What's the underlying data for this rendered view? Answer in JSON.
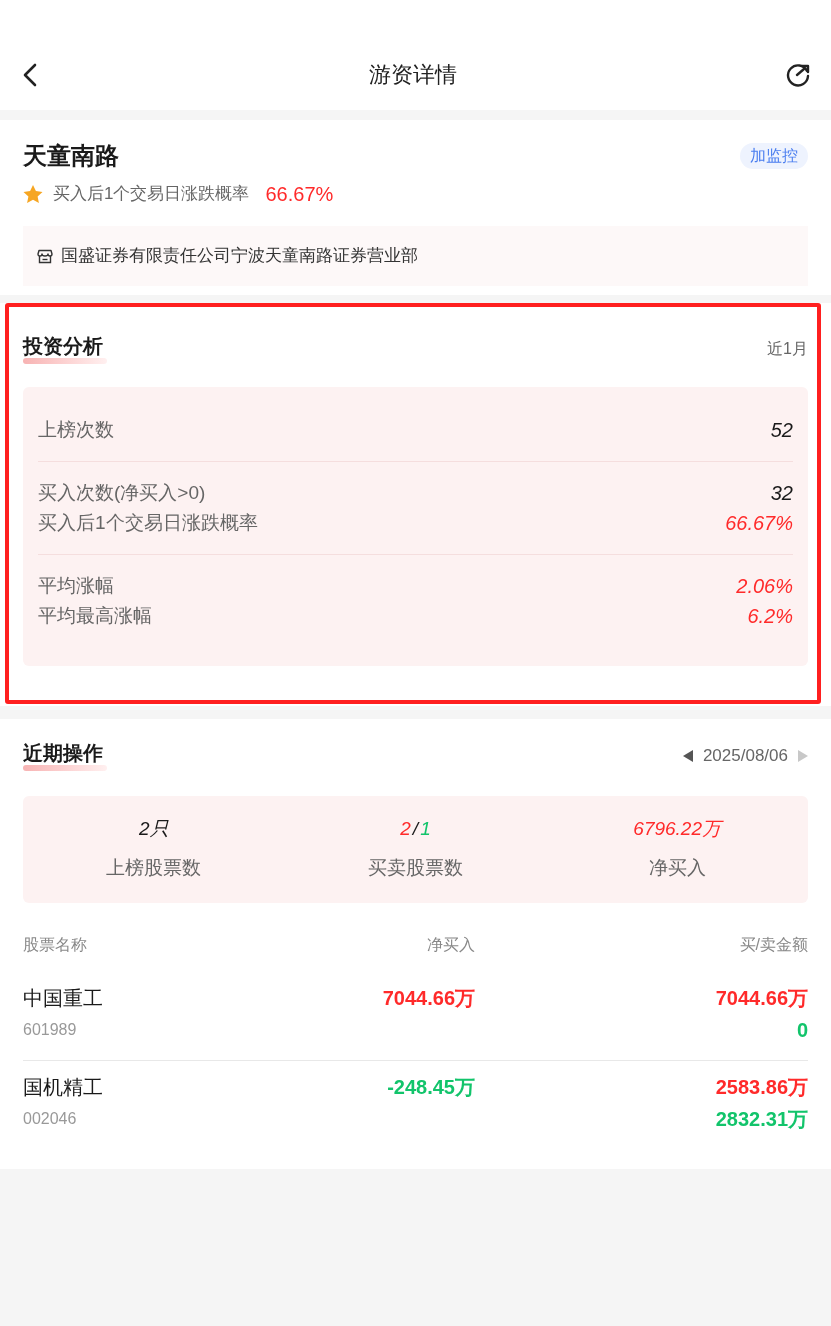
{
  "nav": {
    "title": "游资详情"
  },
  "trader": {
    "name": "天童南路",
    "monitor_button": "加监控",
    "rate_label": "买入后1个交易日涨跌概率",
    "rate_value": "66.67%",
    "branch": "国盛证券有限责任公司宁波天童南路证券营业部"
  },
  "analysis": {
    "title": "投资分析",
    "period": "近1月",
    "highlighted": true,
    "groups": [
      {
        "rows": [
          {
            "label": "上榜次数",
            "value": "52",
            "color": "#1a1a1a"
          }
        ]
      },
      {
        "rows": [
          {
            "label": "买入次数(净买入>0)",
            "value": "32",
            "color": "#1a1a1a"
          },
          {
            "label": "买入后1个交易日涨跌概率",
            "value": "66.67%",
            "color": "#ff2a2a"
          }
        ]
      },
      {
        "rows": [
          {
            "label": "平均涨幅",
            "value": "2.06%",
            "color": "#ff2a2a"
          },
          {
            "label": "平均最高涨幅",
            "value": "6.2%",
            "color": "#ff2a2a"
          }
        ]
      }
    ]
  },
  "recent": {
    "title": "近期操作",
    "date_nav": {
      "date": "2025/08/06",
      "prev_disabled": false,
      "next_disabled": true
    },
    "summary": [
      {
        "kind": "single",
        "value": "2只",
        "color": "#1a1a1a",
        "label": "上榜股票数"
      },
      {
        "kind": "split",
        "buy": "2",
        "separator": "/",
        "sell": "1",
        "label": "买卖股票数"
      },
      {
        "kind": "single",
        "value": "6796.22万",
        "color": "#ff2a2a",
        "label": "净买入"
      }
    ],
    "table": {
      "columns": [
        "股票名称",
        "净买入",
        "买/卖金额"
      ],
      "rows": [
        {
          "name": "中国重工",
          "code": "601989",
          "net_buy": "7044.66万",
          "color": "#ff2a2a",
          "buy": "7044.66万",
          "sell": "0"
        },
        {
          "name": "国机精工",
          "code": "002046",
          "net_buy": "-248.45万",
          "color": "#12c46b",
          "buy": "2583.86万",
          "sell": "2832.31万"
        }
      ]
    }
  }
}
